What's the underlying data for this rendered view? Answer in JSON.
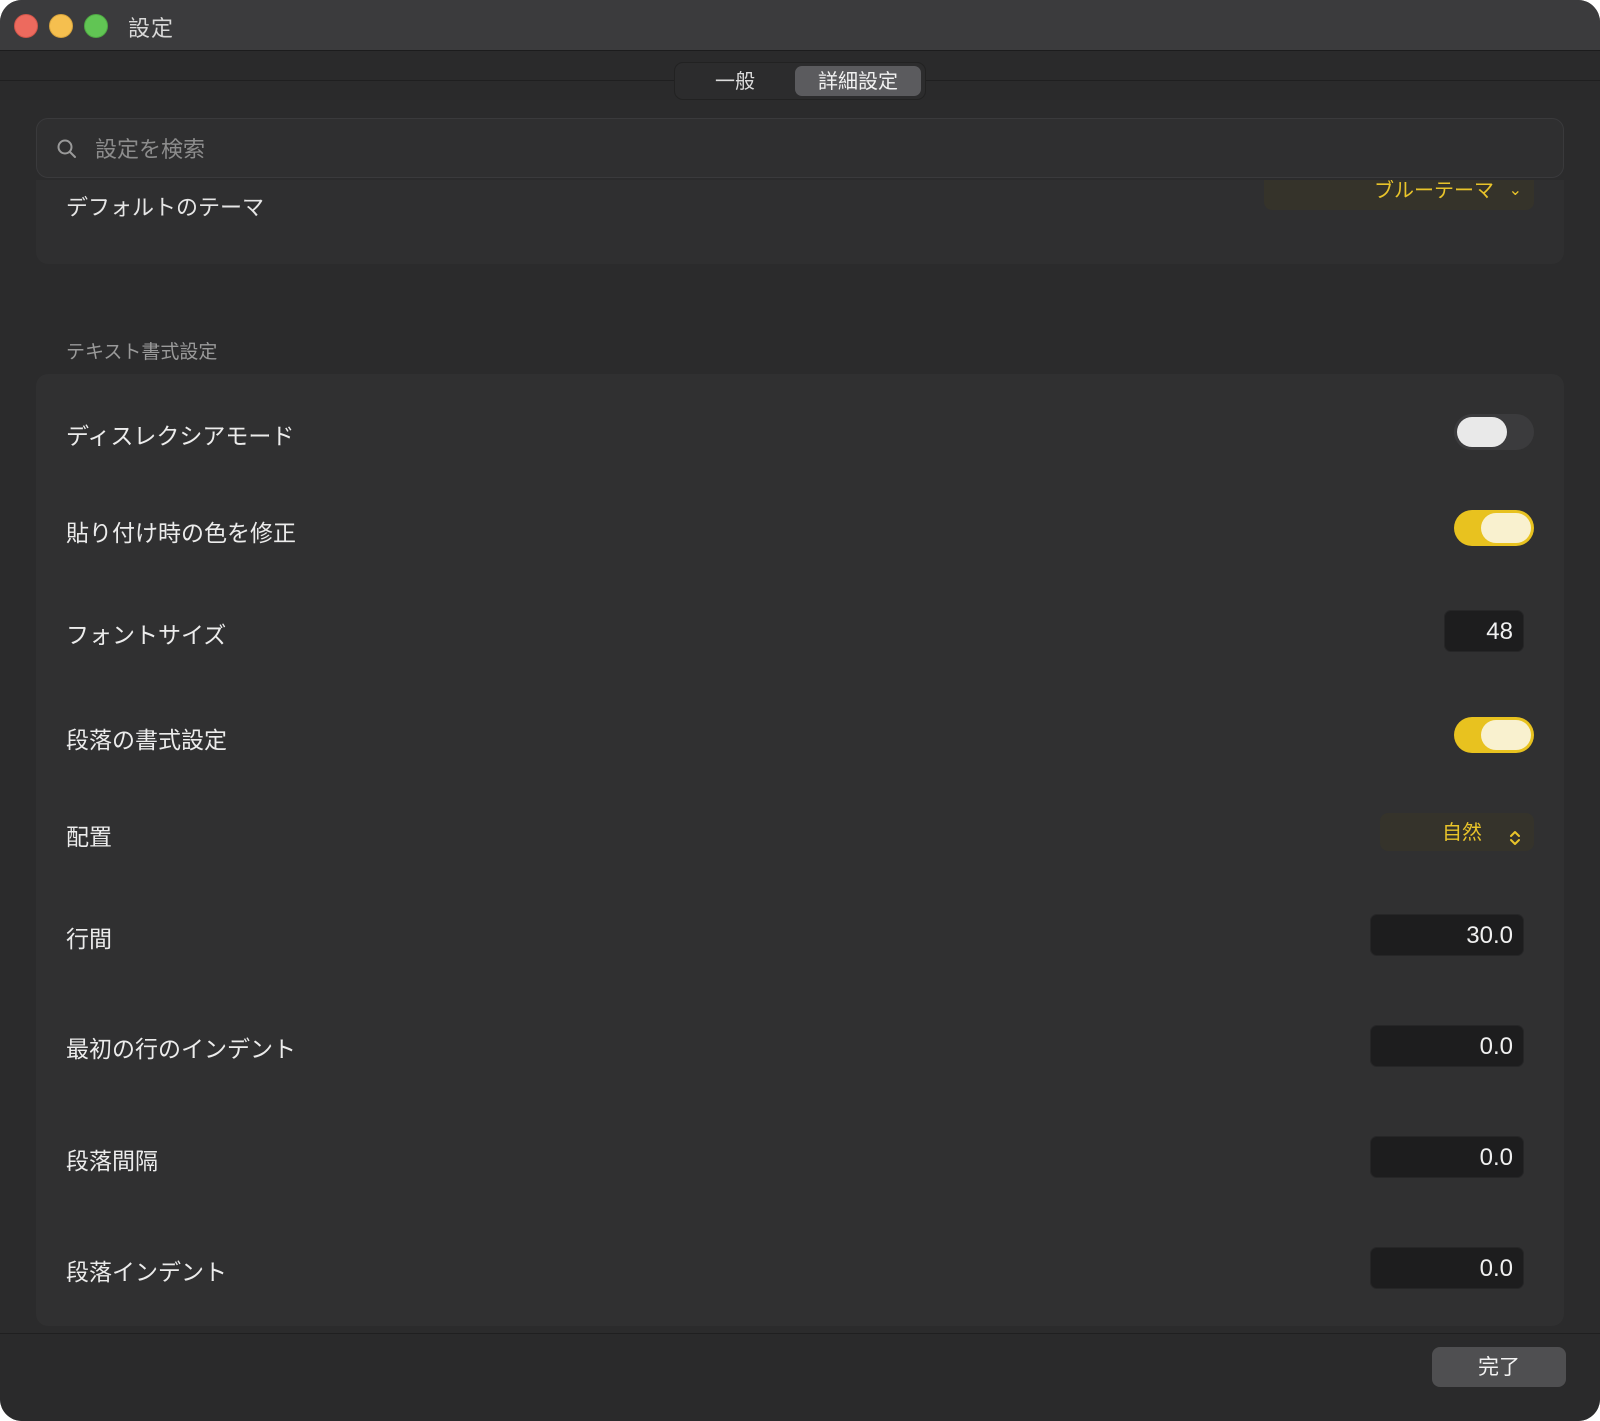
{
  "window": {
    "title": "設定"
  },
  "tabs": [
    {
      "label": "一般",
      "selected": false
    },
    {
      "label": "詳細設定",
      "selected": true
    }
  ],
  "search": {
    "placeholder": "設定を検索",
    "value": ""
  },
  "theme": {
    "label": "デフォルトのテーマ",
    "value": "ブルーテーマ"
  },
  "section": {
    "header": "テキスト書式設定"
  },
  "rows": {
    "dyslexia": {
      "label": "ディスレクシアモード",
      "on": false
    },
    "fix_paste_color": {
      "label": "貼り付け時の色を修正",
      "on": true
    },
    "font_size": {
      "label": "フォントサイズ",
      "value": "48"
    },
    "paragraph_format": {
      "label": "段落の書式設定",
      "on": true
    },
    "alignment": {
      "label": "配置",
      "value": "自然"
    },
    "line_spacing": {
      "label": "行間",
      "value": "30.0"
    },
    "first_line_indent": {
      "label": "最初の行のインデント",
      "value": "0.0"
    },
    "paragraph_spacing": {
      "label": "段落間隔",
      "value": "0.0"
    },
    "paragraph_indent": {
      "label": "段落インデント",
      "value": "0.0"
    }
  },
  "footer": {
    "done_label": "完了"
  },
  "colors": {
    "accent": "#e8c21f",
    "background": "#2a2a2b"
  }
}
